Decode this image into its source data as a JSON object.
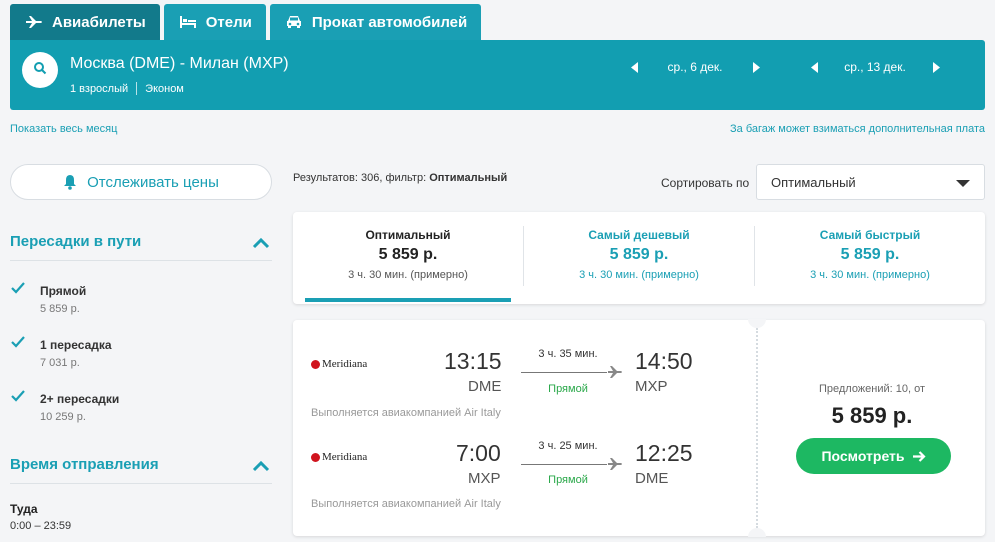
{
  "tabs": [
    {
      "label": "Авиабилеты",
      "icon": "plane-icon",
      "active": true
    },
    {
      "label": "Отели",
      "icon": "bed-icon",
      "active": false
    },
    {
      "label": "Прокат автомобилей",
      "icon": "car-icon",
      "active": false
    }
  ],
  "search": {
    "route": "Москва (DME) - Милан (MXP)",
    "passengers": "1 взрослый",
    "cabin": "Эконом",
    "depart_date": "ср., 6 дек.",
    "return_date": "ср., 13 дек."
  },
  "links": {
    "show_month": "Показать весь месяц",
    "baggage_note": "За багаж может взиматься дополнительная плата"
  },
  "sidebar": {
    "track_label": "Отслеживать цены",
    "stops_title": "Пересадки в пути",
    "stops": [
      {
        "name": "Прямой",
        "price": "5 859 р.",
        "checked": true
      },
      {
        "name": "1 пересадка",
        "price": "7 031 р.",
        "checked": true
      },
      {
        "name": "2+ пересадки",
        "price": "10 259 р.",
        "checked": true
      }
    ],
    "time_title": "Время отправления",
    "direction": "Туда",
    "time_range": "0:00 – 23:59"
  },
  "results": {
    "count_prefix": "Результатов: 306, фильтр:",
    "filter": "Оптимальный"
  },
  "sort": {
    "label": "Сортировать по",
    "selected": "Оптимальный",
    "options": [
      {
        "title": "Оптимальный",
        "price": "5 859 р.",
        "duration": "3 ч. 30 мин. (примерно)",
        "active": true
      },
      {
        "title": "Самый дешевый",
        "price": "5 859 р.",
        "duration": "3 ч. 30 мин. (примерно)",
        "active": false
      },
      {
        "title": "Самый быстрый",
        "price": "5 859 р.",
        "duration": "3 ч. 30 мин. (примерно)",
        "active": false
      }
    ]
  },
  "flight": {
    "segments": [
      {
        "airline": "Meridiana",
        "dep_time": "13:15",
        "dep_code": "DME",
        "duration": "3 ч. 35 мин.",
        "type": "Прямой",
        "arr_time": "14:50",
        "arr_code": "MXP",
        "operator": "Выполняется авиакомпанией Air Italy"
      },
      {
        "airline": "Meridiana",
        "dep_time": "7:00",
        "dep_code": "MXP",
        "duration": "3 ч. 25 мин.",
        "type": "Прямой",
        "arr_time": "12:25",
        "arr_code": "DME",
        "operator": "Выполняется авиакомпанией Air Italy"
      }
    ],
    "offers": "Предложений: 10, от",
    "price": "5 859 р.",
    "view_label": "Посмотреть"
  },
  "colors": {
    "brand": "#129eb1",
    "brand_dark": "#127a8b",
    "accent_green": "#1db862",
    "direct_green": "#2aa84a",
    "airline_red": "#d0141e"
  }
}
